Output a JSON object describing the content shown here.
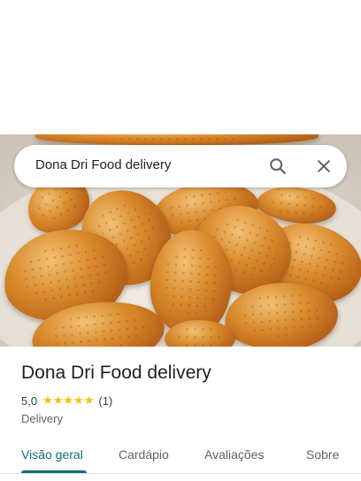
{
  "search": {
    "query": "Dona Dri Food delivery",
    "search_icon": "search-icon",
    "close_icon": "close-icon"
  },
  "place": {
    "name": "Dona Dri Food delivery",
    "rating": "5,0",
    "stars": "★★★★★",
    "review_count": "(1)",
    "category": "Delivery"
  },
  "tabs": [
    {
      "label": "Visão geral",
      "active": true
    },
    {
      "label": "Cardápio",
      "active": false
    },
    {
      "label": "Avaliações",
      "active": false
    },
    {
      "label": "Sobre",
      "active": false
    }
  ],
  "colors": {
    "accent": "#0b6f76",
    "star": "#fbbc04"
  }
}
